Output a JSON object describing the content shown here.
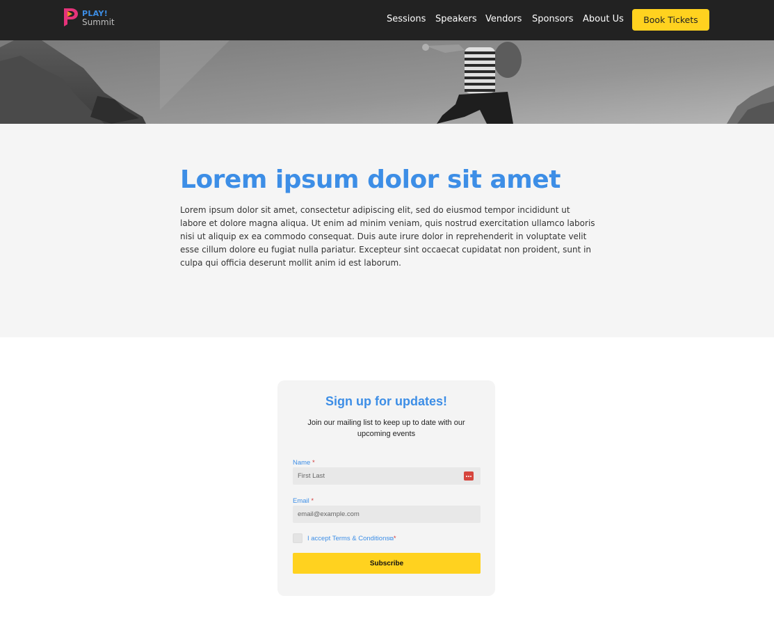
{
  "brand": {
    "line1": "PLAY!",
    "line2": "Summit",
    "accent_blue": "#3d8ee6",
    "accent_yellow": "#ffd21f",
    "logo_pink": "#e6337a"
  },
  "nav": {
    "items": [
      {
        "label": "Sessions"
      },
      {
        "label": "Speakers"
      },
      {
        "label": "Vendors"
      },
      {
        "label": "Sponsors"
      },
      {
        "label": "About Us"
      }
    ],
    "cta_label": "Book Tickets"
  },
  "intro": {
    "title": "Lorem ipsum dolor sit amet",
    "body": "Lorem ipsum dolor sit amet, consectetur adipiscing elit, sed do eiusmod tempor incididunt ut labore et dolore magna aliqua. Ut enim ad minim veniam, quis nostrud exercitation ullamco laboris nisi ut aliquip ex ea commodo consequat. Duis aute irure dolor in reprehenderit in voluptate velit esse cillum dolore eu fugiat nulla pariatur. Excepteur sint occaecat cupidatat non proident, sunt in culpa qui officia deserunt mollit anim id est laborum."
  },
  "signup": {
    "title": "Sign up for updates!",
    "description": "Join our mailing list to keep up to date with our upcoming events",
    "name_label": "Name",
    "name_placeholder": "First Last",
    "email_label": "Email",
    "email_placeholder": "email@example.com",
    "required_mark": "*",
    "terms_text": "I accept Terms & Conditions",
    "subscribe_label": "Subscribe"
  }
}
